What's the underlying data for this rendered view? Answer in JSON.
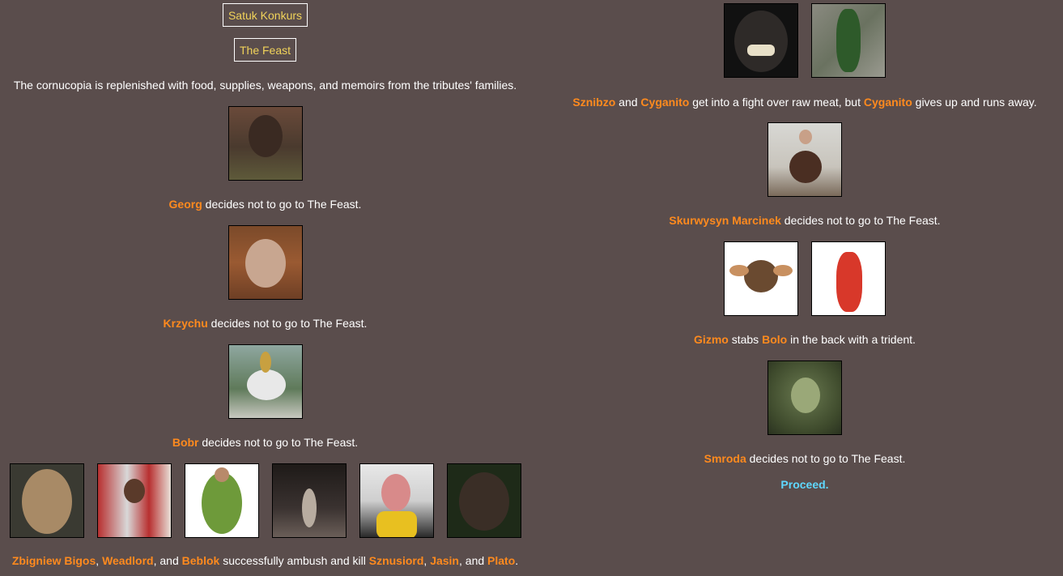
{
  "header": {
    "site_button": "Satuk Konkurs",
    "event_button": "The Feast"
  },
  "intro": "The cornucopia is replenished with food, supplies, weapons, and memoirs from the tributes' families.",
  "events_left": [
    {
      "names": [
        "Georg"
      ],
      "text": " decides not to go to The Feast."
    },
    {
      "names": [
        "Krzychu"
      ],
      "text": " decides not to go to The Feast."
    },
    {
      "names": [
        "Bobr"
      ],
      "text": " decides not to go to The Feast."
    }
  ],
  "ambush": {
    "killer1": "Zbigniew Bigos",
    "sep1": ", ",
    "killer2": "Weadlord",
    "sep2": ", and ",
    "killer3": "Beblok",
    "mid": " successfully ambush and kill ",
    "victim1": "Sznusiord",
    "sep3": ", ",
    "victim2": "Jasin",
    "sep4": ", and ",
    "victim3": "Plato",
    "end": "."
  },
  "fight": {
    "a": "Sznibzo",
    "and": " and ",
    "b": "Cyganito",
    "mid": " get into a fight over raw meat, but ",
    "c": "Cyganito",
    "end": " gives up and runs away."
  },
  "skurwysyn": {
    "name": "Skurwysyn Marcinek",
    "text": " decides not to go to The Feast."
  },
  "stab": {
    "a": "Gizmo",
    "mid": " stabs ",
    "b": "Bolo",
    "end": " in the back with a trident."
  },
  "smroda": {
    "name": "Smroda",
    "text": " decides not to go to The Feast."
  },
  "proceed": "Proceed.",
  "colors": {
    "background": "#5a4d4c",
    "name": "#ff8a1e",
    "button_text": "#f1d35a",
    "proceed": "#5fd8ff"
  }
}
